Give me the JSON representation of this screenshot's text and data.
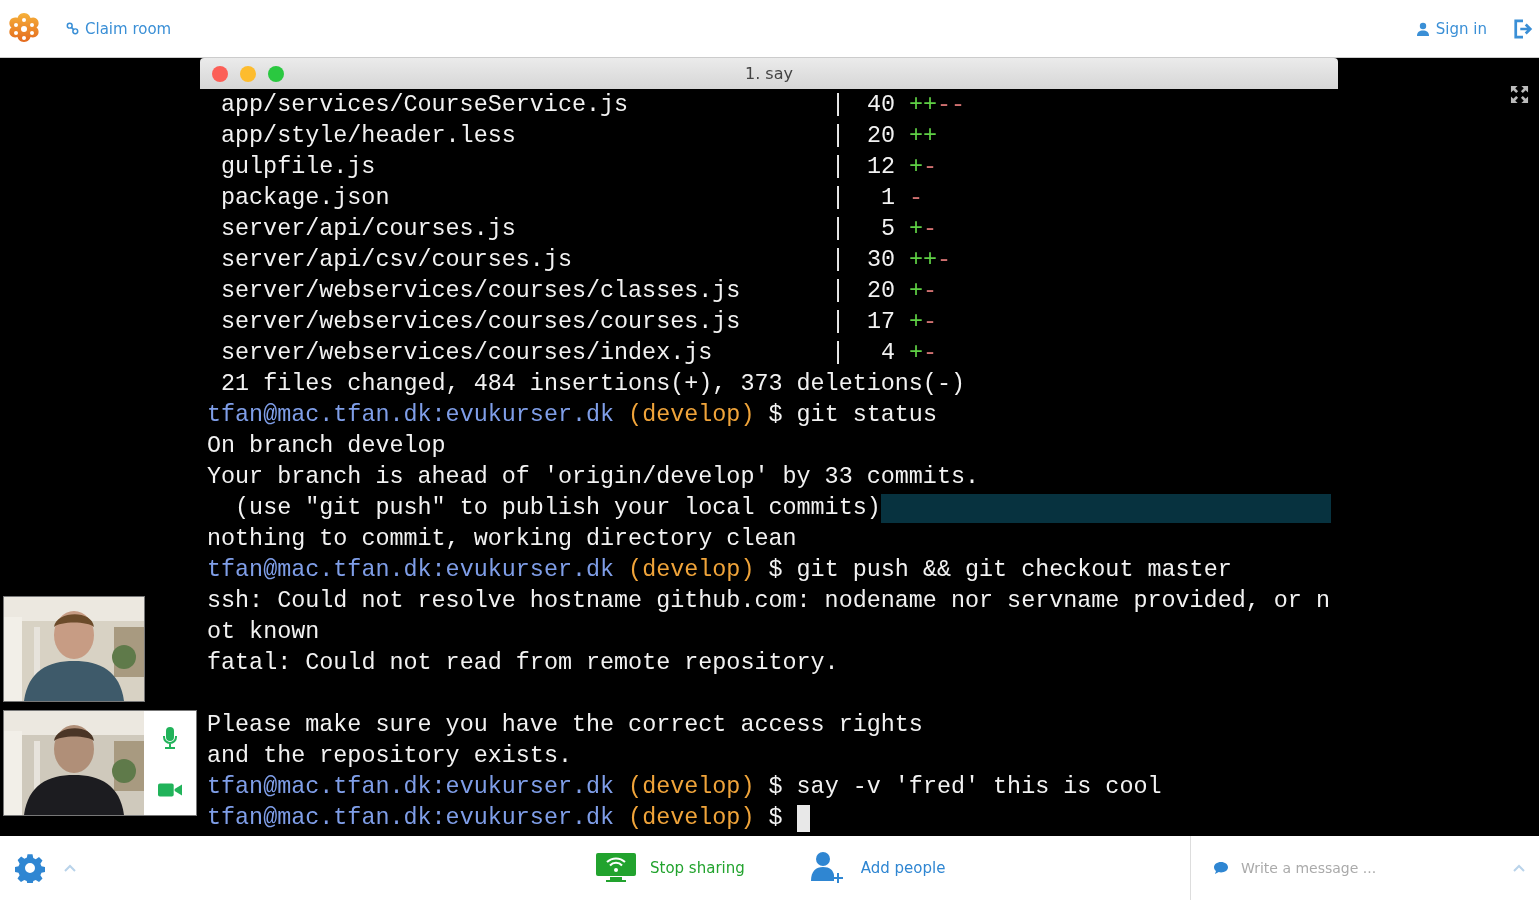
{
  "header": {
    "claim_link": "Claim room",
    "sign_in": "Sign in"
  },
  "terminal": {
    "title": "1. say",
    "lines": [
      {
        "kind": "diffstat",
        "file": "app/services/CourseService.js",
        "pipe": "|",
        "count": "40",
        "plus": "++",
        "minus": "--"
      },
      {
        "kind": "diffstat",
        "file": "app/style/header.less",
        "pipe": "|",
        "count": "20",
        "plus": "++"
      },
      {
        "kind": "diffstat",
        "file": "gulpfile.js",
        "pipe": "|",
        "count": "12",
        "plus": "+",
        "minus": "-"
      },
      {
        "kind": "diffstat",
        "file": "package.json",
        "pipe": "|",
        "count": "1",
        "minus": "-"
      },
      {
        "kind": "diffstat",
        "file": "server/api/courses.js",
        "pipe": "|",
        "count": "5",
        "plus": "+",
        "minus": "-"
      },
      {
        "kind": "diffstat",
        "file": "server/api/csv/courses.js",
        "pipe": "|",
        "count": "30",
        "plus": "++",
        "minus": "-"
      },
      {
        "kind": "diffstat",
        "file": "server/webservices/courses/classes.js",
        "pipe": "|",
        "count": "20",
        "plus": "+",
        "minus": "-"
      },
      {
        "kind": "diffstat",
        "file": "server/webservices/courses/courses.js",
        "pipe": "|",
        "count": "17",
        "plus": "+",
        "minus": "-"
      },
      {
        "kind": "diffstat",
        "file": "server/webservices/courses/index.js",
        "pipe": "|",
        "count": "4",
        "plus": "+",
        "minus": "-"
      },
      {
        "kind": "text",
        "text": " 21 files changed, 484 insertions(+), 373 deletions(-)",
        "highlighted": false
      },
      {
        "kind": "prompt",
        "user": "tfan@mac.tfan.dk:evukurser.dk",
        "branch": "(develop)",
        "symbol": "$",
        "command": "git status",
        "cursor": false
      },
      {
        "kind": "text",
        "text": "On branch develop",
        "highlighted": false
      },
      {
        "kind": "text",
        "text": "Your branch is ahead of 'origin/develop' by 33 commits.",
        "highlighted": false
      },
      {
        "kind": "text",
        "text": "  (use \"git push\" to publish your local commits)",
        "highlighted": true
      },
      {
        "kind": "text",
        "text": "nothing to commit, working directory clean",
        "highlighted": false
      },
      {
        "kind": "prompt",
        "user": "tfan@mac.tfan.dk:evukurser.dk",
        "branch": "(develop)",
        "symbol": "$",
        "command": "git push && git checkout master",
        "cursor": false
      },
      {
        "kind": "text",
        "text": "ssh: Could not resolve hostname github.com: nodename nor servname provided, or n",
        "highlighted": false
      },
      {
        "kind": "text",
        "text": "ot known",
        "highlighted": false
      },
      {
        "kind": "text",
        "text": "fatal: Could not read from remote repository.",
        "highlighted": false
      },
      {
        "kind": "blank"
      },
      {
        "kind": "text",
        "text": "Please make sure you have the correct access rights",
        "highlighted": false
      },
      {
        "kind": "text",
        "text": "and the repository exists.",
        "highlighted": false
      },
      {
        "kind": "prompt",
        "user": "tfan@mac.tfan.dk:evukurser.dk",
        "branch": "(develop)",
        "symbol": "$",
        "command": "say -v 'fred' this is cool",
        "cursor": false
      },
      {
        "kind": "prompt",
        "user": "tfan@mac.tfan.dk:evukurser.dk",
        "branch": "(develop)",
        "symbol": "$",
        "cursor": true
      }
    ]
  },
  "videos": [
    {
      "kind": "remote"
    },
    {
      "kind": "local",
      "mic_on": true,
      "camera_on": true
    }
  ],
  "toolbar": {
    "stop_sharing": "Stop sharing",
    "add_people": "Add people",
    "message_placeholder": "Write a message ..."
  }
}
